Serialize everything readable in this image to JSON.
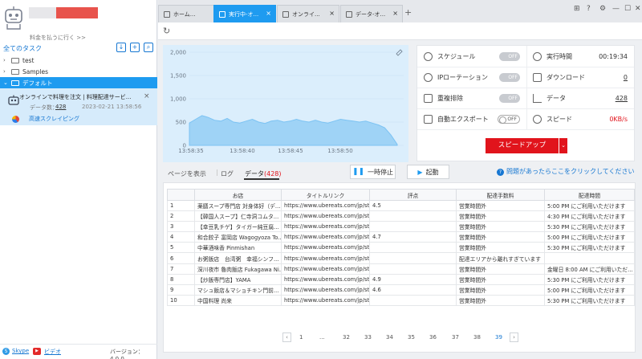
{
  "sidebar": {
    "pay_link": "料金を払うに行く >>",
    "all_tasks": "全てのタスク",
    "folders": [
      {
        "label": "test",
        "expanded": false
      },
      {
        "label": "Samples",
        "expanded": false
      },
      {
        "label": "デフォルト",
        "expanded": true
      }
    ],
    "task": {
      "title": "オンラインで料理を注文 | 料理配達サービ...",
      "count_label": "データ数：",
      "count": "428",
      "date": "2023-02-21 13:58:56",
      "mode": "高速スクレイピング"
    },
    "footer": {
      "skype": "Skype",
      "video": "ビデオ",
      "version": "バージョン：4.0.0"
    }
  },
  "tabs": [
    {
      "label": "ホーム...",
      "active": false,
      "closable": false
    },
    {
      "label": "実行中-オ...",
      "active": true,
      "closable": true
    },
    {
      "label": "オンライ...",
      "active": false,
      "closable": true
    },
    {
      "label": "データ-オ...",
      "active": false,
      "closable": true
    }
  ],
  "stats": {
    "schedule_label": "スケジュール",
    "schedule_state": "OFF",
    "runtime_label": "実行時間",
    "runtime": "00:19:34",
    "ip_label": "IPローテーション",
    "ip_state": "OFF",
    "download_label": "ダウンロード",
    "download": "0",
    "dedup_label": "重複排除",
    "dedup_state": "OFF",
    "data_label": "データ",
    "data": "428",
    "export_label": "自動エクスポート",
    "export_state": "OFF",
    "speed_label": "スピード",
    "speed": "0KB/s",
    "speedup_button": "スピードアップ"
  },
  "chart_data": {
    "type": "area",
    "x_ticks": [
      "13:58:35",
      "13:58:40",
      "13:58:45",
      "13:58:50"
    ],
    "y_ticks": [
      "0",
      "500",
      "1,000",
      "1,500",
      "2,000"
    ],
    "ylim": [
      0,
      2000
    ],
    "values": [
      480,
      560,
      640,
      600,
      540,
      520,
      580,
      500,
      480,
      520,
      560,
      500,
      470,
      520,
      540,
      500,
      520,
      560,
      520,
      500,
      540,
      500,
      480,
      520,
      560,
      540,
      520,
      500,
      520,
      480,
      440,
      380,
      220,
      20
    ],
    "color": "#7cc3f3"
  },
  "controls": {
    "tab_page": "ページを表示",
    "tab_log": "ログ",
    "tab_data": "データ",
    "tab_data_count": "(428)",
    "pause": "一時停止",
    "start": "起動",
    "help": "問題があったらここをクリックしてください"
  },
  "table": {
    "headers": [
      "",
      "お店",
      "タイトルリンク",
      "評点",
      "配達手数料",
      "配達時間"
    ],
    "rows": [
      [
        "1",
        "薬膳スープ専門店 対身体好（デ...",
        "https://www.ubereats.com/jp/stor...",
        "4.5",
        "営業時間外",
        "5:00 PM にご利用いただけます"
      ],
      [
        "2",
        "【韓国人スープ】仁寺洞コムタ...",
        "https://www.ubereats.com/jp/stor...",
        "",
        "営業時間外",
        "4:30 PM にご利用いただけます"
      ],
      [
        "3",
        "【幸豆乳チゲ】タイガー純豆腐...",
        "https://www.ubereats.com/jp/stor...",
        "",
        "営業時間外",
        "5:30 PM にご利用いただけます"
      ],
      [
        "4",
        "和合餃子 富岡店 Wagogyoza To...",
        "https://www.ubereats.com/jp/stor...",
        "4.7",
        "営業時間外",
        "5:00 PM にご利用いただけます"
      ],
      [
        "5",
        "中華酒味香 Pinmishan",
        "https://www.ubereats.com/jp/stor...",
        "",
        "営業時間外",
        "5:30 PM にご利用いただけます"
      ],
      [
        "6",
        "お粥飯店　台湾粥　幸福シンフ...",
        "https://www.ubereats.com/jp/stor...",
        "",
        "配達エリアから離れすぎています",
        ""
      ],
      [
        "7",
        "深川夜市 魯肉飯店 Fukagawa Ni...",
        "https://www.ubereats.com/jp/stor...",
        "",
        "営業時間外",
        "金曜日 8:00 AM にご利用いただ..."
      ],
      [
        "8",
        "【炒飯専門店】YAMA",
        "https://www.ubereats.com/jp/stor...",
        "4.9",
        "営業時間外",
        "5:30 PM にご利用いただけます"
      ],
      [
        "9",
        "マシュ飯店＆マショチキン門前...",
        "https://www.ubereats.com/jp/stor...",
        "4.6",
        "営業時間外",
        "5:00 PM にご利用いただけます"
      ],
      [
        "10",
        "中国料理 尚来",
        "https://www.ubereats.com/jp/stor...",
        "",
        "営業時間外",
        "5:30 PM にご利用いただけます"
      ]
    ]
  },
  "pager": {
    "pages": [
      "1",
      "...",
      "32",
      "33",
      "34",
      "35",
      "36",
      "37",
      "38",
      "39"
    ],
    "current": "39"
  }
}
